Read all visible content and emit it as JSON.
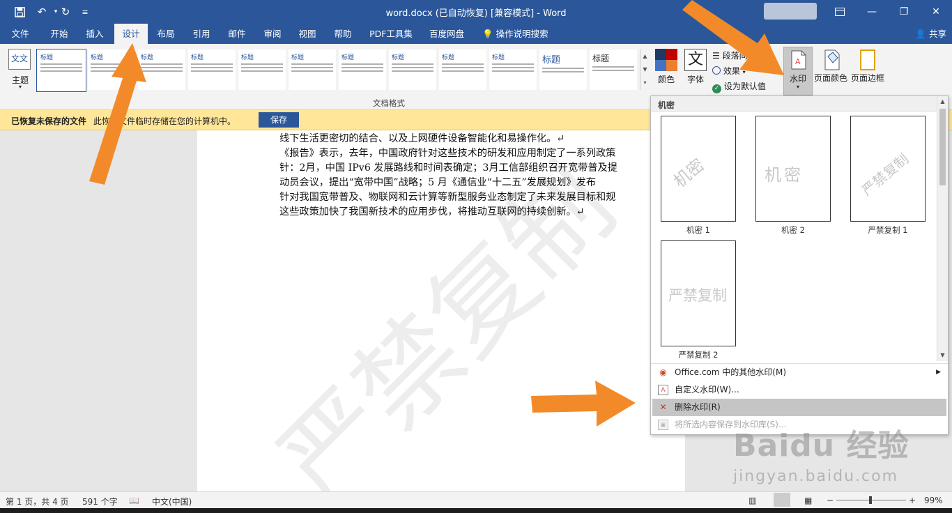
{
  "window": {
    "title": "word.docx (已自动恢复) [兼容模式]  -  Word",
    "minimize": "—",
    "restore": "❐",
    "close": "✕"
  },
  "quick_access": {
    "save_icon": "save-icon",
    "undo_icon": "undo-icon",
    "redo_icon": "redo-icon",
    "customize_icon": "customize-icon"
  },
  "tabs": [
    "文件",
    "开始",
    "插入",
    "设计",
    "布局",
    "引用",
    "邮件",
    "审阅",
    "视图",
    "帮助",
    "PDF工具集",
    "百度网盘"
  ],
  "active_tab": "设计",
  "tell_me": "操作说明搜索",
  "share": "共享",
  "ribbon": {
    "theme_label": "主题",
    "gallery_group_label": "文档格式",
    "gallery_items": [
      "标题",
      "标题",
      "标题",
      "标题",
      "标题",
      "标题",
      "标题",
      "标题",
      "标题",
      "标题",
      "标题",
      "标题"
    ],
    "colors_label": "颜色",
    "fonts_label": "字体",
    "paragraph_spacing_label": "段落间距",
    "effects_label": "效果",
    "set_default_label": "设为默认值",
    "watermark_label": "水印",
    "page_color_label": "页面颜色",
    "page_borders_label": "页面边框"
  },
  "infobar": {
    "title": "已恢复未保存的文件",
    "message": "此恢复文件临时存储在您的计算机中。",
    "save_button": "保存"
  },
  "document": {
    "lines": [
      "线下生活更密切的结合、以及上网硬件设备智能化和易操作化。↵",
      "《报告》表示，去年，中国政府针对这些技术的研发和应用制定了一系列政策",
      "针：2月，中国 IPv6 发展路线和时间表确定；3月工信部组织召开宽带普及提",
      "动员会议，提出“宽带中国”战略；5 月《通信业“十二五”发展规划》发布",
      "针对我国宽带普及、物联网和云计算等新型服务业态制定了未来发展目标和规",
      "这些政策加快了我国新技术的应用步伐，将推动互联网的持续创新。↵"
    ],
    "watermark_text": "严禁复制"
  },
  "watermark_menu": {
    "section": "机密",
    "items": [
      {
        "label": "机密 1",
        "text": "机密"
      },
      {
        "label": "机密 2",
        "text": "机密"
      },
      {
        "label": "严禁复制 1",
        "text": "严禁复制"
      },
      {
        "label": "严禁复制 2",
        "text": "严禁复制"
      }
    ],
    "commands": [
      {
        "label": "Office.com 中的其他水印(M)",
        "icon": "globe-icon"
      },
      {
        "label": "自定义水印(W)...",
        "icon": "custom-watermark-icon"
      },
      {
        "label": "删除水印(R)",
        "icon": "delete-watermark-icon"
      },
      {
        "label": "将所选内容保存到水印库(S)...",
        "icon": "save-to-gallery-icon"
      }
    ]
  },
  "statusbar": {
    "page": "第 1 页，共 4 页",
    "words": "591 个字",
    "language": "中文(中国)",
    "zoom": "99%",
    "zoom_out": "−",
    "zoom_in": "+"
  },
  "overlay": {
    "baidu_logo": "Baidu 经验",
    "baidu_url": "jingyan.baidu.com",
    "arrow_color": "#f38a2a"
  }
}
